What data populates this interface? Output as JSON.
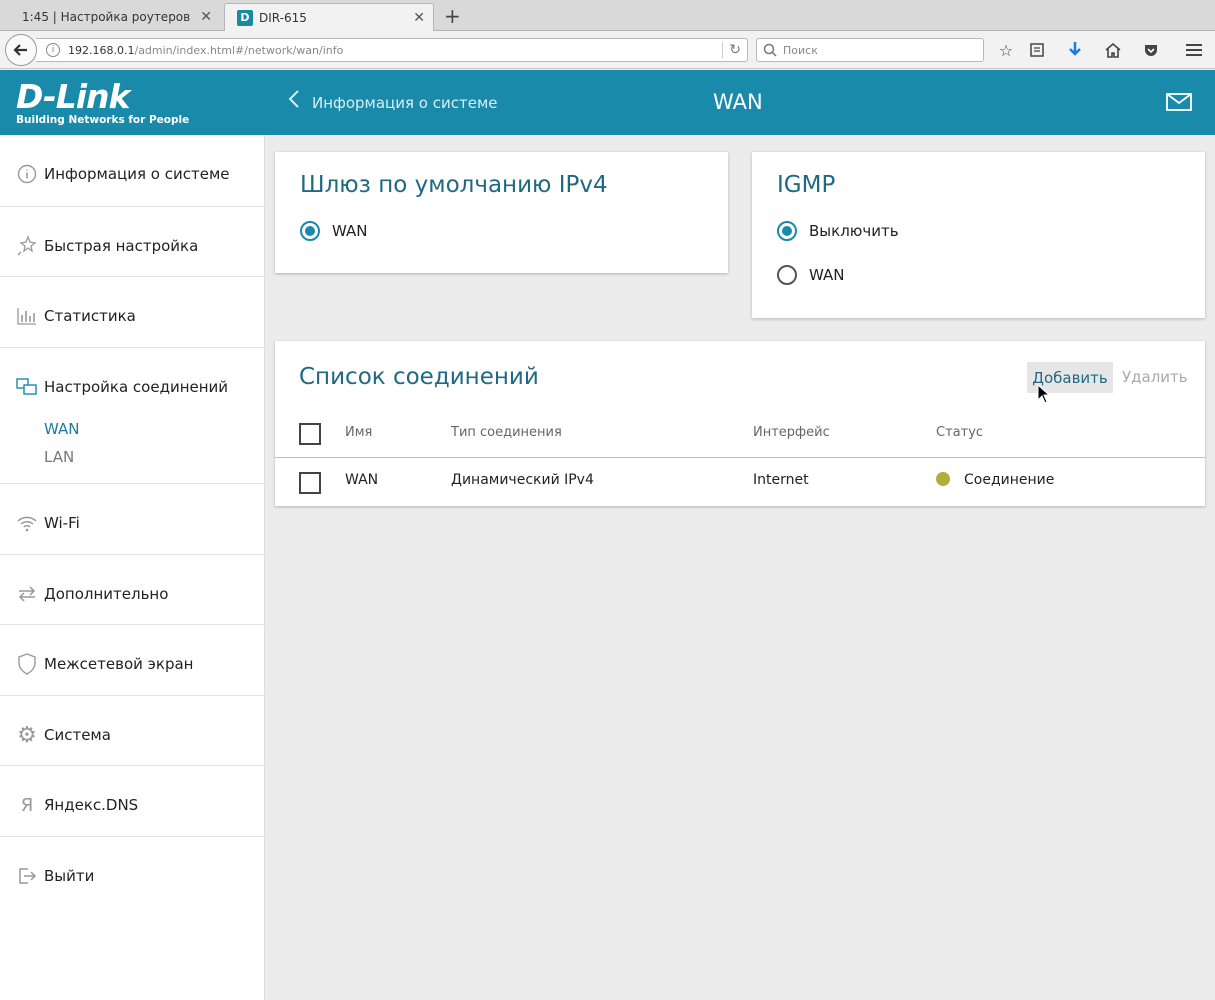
{
  "browser": {
    "tabs": [
      {
        "label": "1:45 | Настройка роутеров",
        "active": false
      },
      {
        "label": "DIR-615",
        "active": true,
        "favicon": "D"
      }
    ],
    "url_host": "192.168.0.1",
    "url_path": "/admin/index.html#/network/wan/info",
    "search_placeholder": "Поиск"
  },
  "header": {
    "brand": "D-Link",
    "tagline": "Building Networks for People",
    "back_label": "Информация о системе",
    "page_title": "WAN",
    "accent_color": "#1a8aab"
  },
  "sidebar": {
    "items": [
      {
        "label": "Информация о системе",
        "icon": "info-icon"
      },
      {
        "label": "Быстрая настройка",
        "icon": "wand-icon"
      },
      {
        "label": "Статистика",
        "icon": "stats-icon"
      },
      {
        "label": "Настройка соединений",
        "icon": "network-icon"
      },
      {
        "label": "Wi-Fi",
        "icon": "wifi-icon"
      },
      {
        "label": "Дополнительно",
        "icon": "arrows-icon"
      },
      {
        "label": "Межсетевой экран",
        "icon": "shield-icon"
      },
      {
        "label": "Система",
        "icon": "gear-icon"
      },
      {
        "label": "Яндекс.DNS",
        "icon": "yandex-icon"
      },
      {
        "label": "Выйти",
        "icon": "logout-icon"
      }
    ],
    "subitems": [
      {
        "label": "WAN",
        "active": true
      },
      {
        "label": "LAN",
        "active": false
      }
    ]
  },
  "gateway_card": {
    "title": "Шлюз по умолчанию IPv4",
    "options": [
      {
        "label": "WAN",
        "selected": true
      }
    ]
  },
  "igmp_card": {
    "title": "IGMP",
    "options": [
      {
        "label": "Выключить",
        "selected": true
      },
      {
        "label": "WAN",
        "selected": false
      }
    ]
  },
  "connections": {
    "title": "Список соединений",
    "add_label": "Добавить",
    "delete_label": "Удалить",
    "columns": [
      "Имя",
      "Тип соединения",
      "Интерфейс",
      "Статус"
    ],
    "rows": [
      {
        "name": "WAN",
        "type": "Динамический IPv4",
        "interface": "Internet",
        "status": "Соединение",
        "status_color": "#b5aa3a"
      }
    ]
  }
}
